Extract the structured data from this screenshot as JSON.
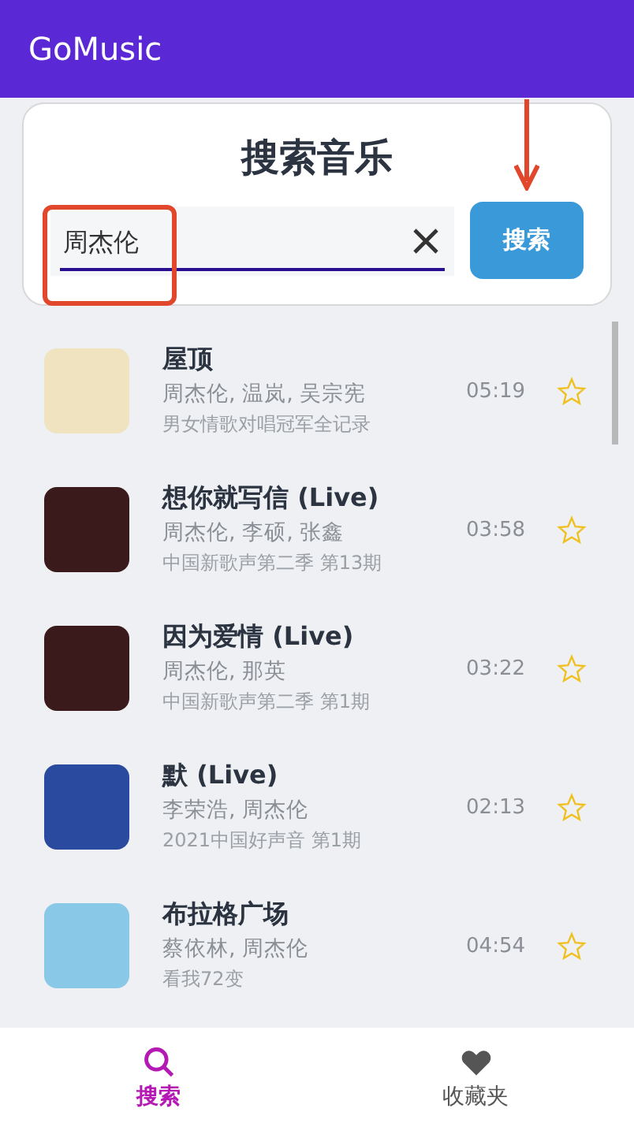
{
  "app_bar": {
    "title": "GoMusic"
  },
  "search_card": {
    "title": "搜索音乐",
    "query": "周杰伦",
    "button": "搜索"
  },
  "songs": [
    {
      "title": "屋顶",
      "artists": "周杰伦, 温岚, 吴宗宪",
      "album": "男女情歌对唱冠军全记录",
      "duration": "05:19",
      "favorite": false
    },
    {
      "title": "想你就写信 (Live)",
      "artists": "周杰伦, 李硕, 张鑫",
      "album": "中国新歌声第二季 第13期",
      "duration": "03:58",
      "favorite": false
    },
    {
      "title": "因为爱情 (Live)",
      "artists": "周杰伦, 那英",
      "album": "中国新歌声第二季 第1期",
      "duration": "03:22",
      "favorite": false
    },
    {
      "title": "默 (Live)",
      "artists": "李荣浩, 周杰伦",
      "album": "2021中国好声音 第1期",
      "duration": "02:13",
      "favorite": false
    },
    {
      "title": "布拉格广场",
      "artists": "蔡依林, 周杰伦",
      "album": "看我72变",
      "duration": "04:54",
      "favorite": false
    }
  ],
  "bottom_nav": [
    {
      "label": "搜索",
      "kind": "search",
      "selected": true
    },
    {
      "label": "收藏夹",
      "kind": "favorites",
      "selected": false
    }
  ]
}
